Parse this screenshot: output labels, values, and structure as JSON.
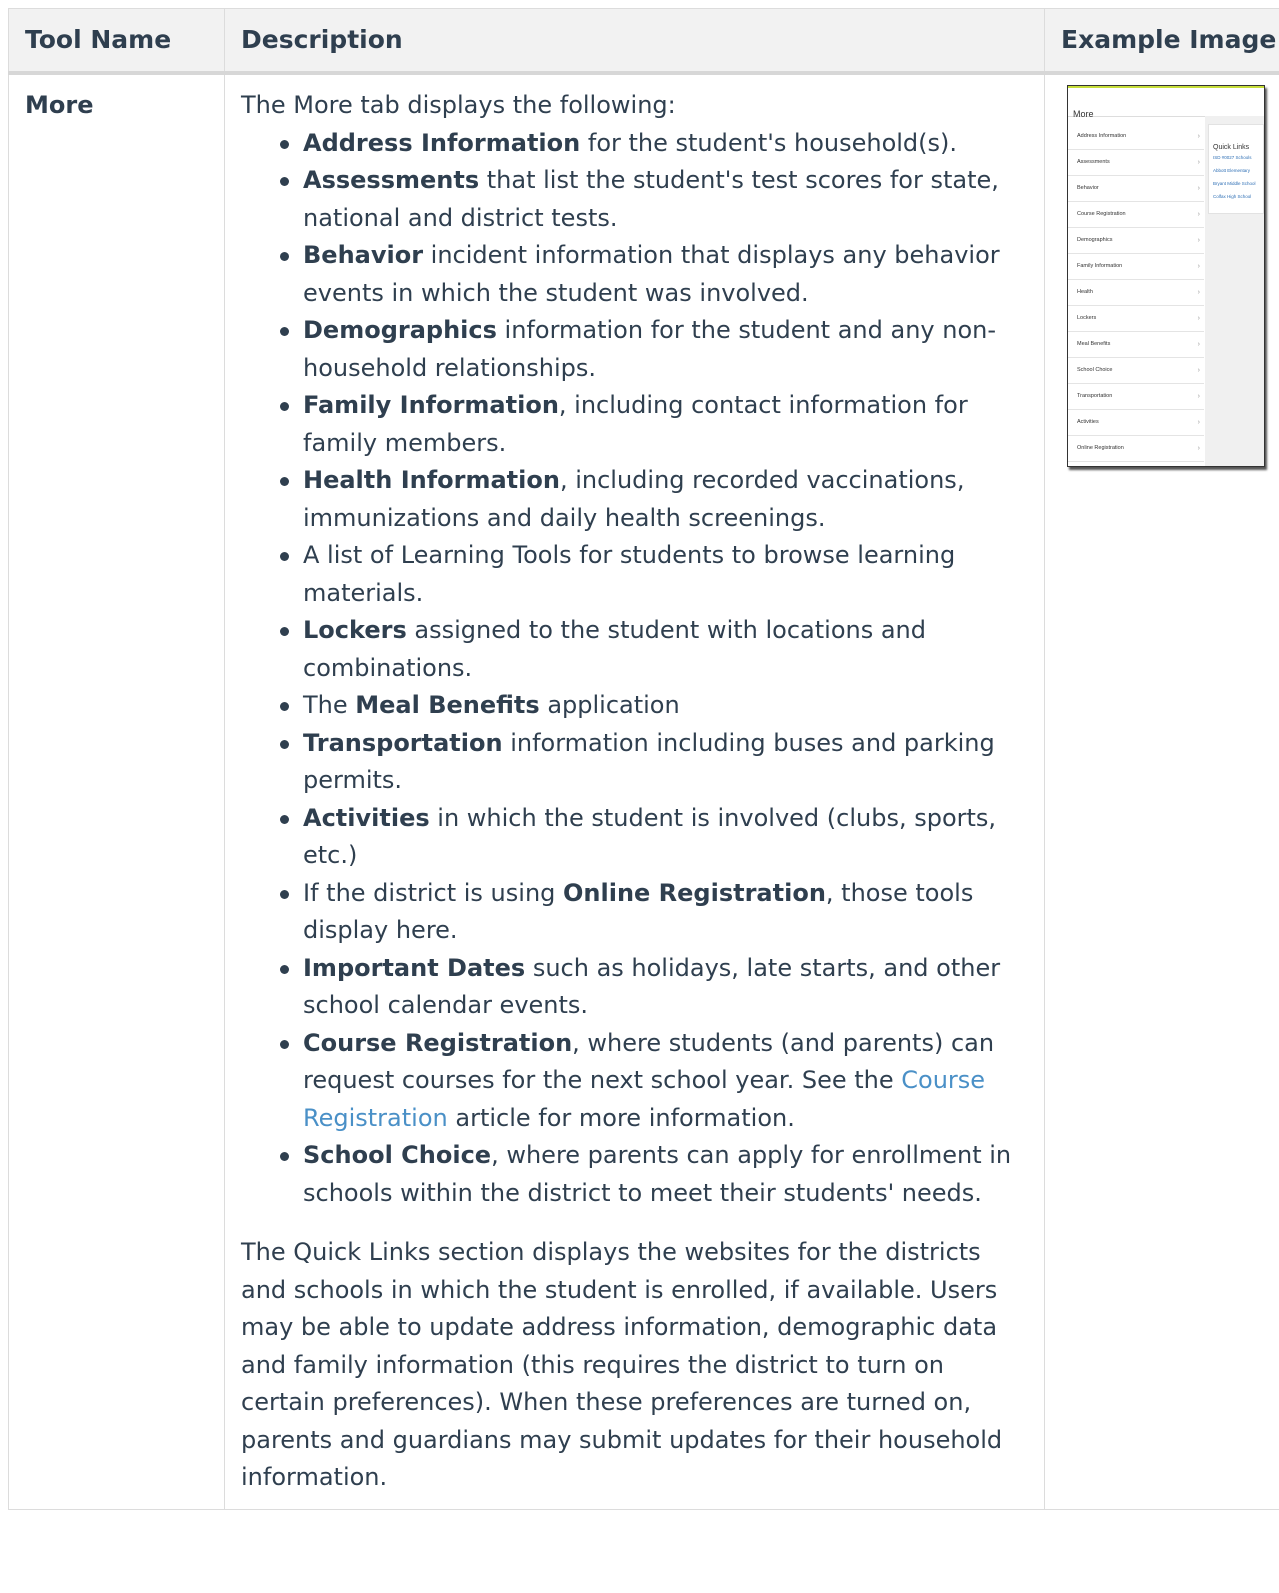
{
  "table": {
    "headers": [
      "Tool Name",
      "Description",
      "Example Image"
    ]
  },
  "row": {
    "tool_name": "More",
    "intro": "The More tab displays the following:",
    "items": [
      {
        "pre": "",
        "bold": "Address Information",
        "post": " for the student's household(s)."
      },
      {
        "pre": "",
        "bold": "Assessments",
        "post": " that list the student's test scores for state, national and district tests."
      },
      {
        "pre": "",
        "bold": "Behavior",
        "post": " incident information that displays any behavior events in which the student was involved."
      },
      {
        "pre": "",
        "bold": "Demographics",
        "post": " information for the student and any non-household relationships."
      },
      {
        "pre": "",
        "bold": "Family Information",
        "post": ", including contact information for family members."
      },
      {
        "pre": "",
        "bold": "Health Information",
        "post": ", including recorded vaccinations, immunizations and daily health screenings."
      },
      {
        "pre": "A list of Learning Tools for students to browse learning materials.",
        "bold": "",
        "post": ""
      },
      {
        "pre": "",
        "bold": "Lockers",
        "post": " assigned to the student with locations and combinations."
      },
      {
        "pre": "The ",
        "bold": "Meal Benefits",
        "post": " application"
      },
      {
        "pre": "",
        "bold": "Transportation",
        "post": " information including buses and parking permits."
      },
      {
        "pre": "",
        "bold": "Activities",
        "post": " in which the student is involved (clubs, sports, etc.)"
      },
      {
        "pre": "If the district is using ",
        "bold": "Online Registration",
        "post": ", those tools display here."
      },
      {
        "pre": "",
        "bold": "Important Dates",
        "post": " such as holidays, late starts, and other school calendar events."
      }
    ],
    "course_registration": {
      "bold": "Course Registration",
      "text1": ", where students (and parents) can request courses for the next school year. See the ",
      "link": "Course Registration",
      "text2": " article for more information."
    },
    "school_choice": {
      "bold": "School Choice",
      "text": ", where parents can apply for enrollment in schools within the district to meet their students' needs."
    },
    "quick_links_paragraph": "The Quick Links section displays the websites for the districts and schools in which the student is enrolled, if available. Users may be able to update address information, demographic data and family information (this requires the district to turn on certain preferences). When these preferences are turned on, parents and guardians may submit updates for their household information."
  },
  "example_image": {
    "title": "More",
    "list": [
      "Address Information",
      "Assessments",
      "Behavior",
      "Course Registration",
      "Demographics",
      "Family Information",
      "Health",
      "Lockers",
      "Meal Benefits",
      "School Choice",
      "Transportation",
      "Activities",
      "Online Registration"
    ],
    "quick_links_title": "Quick Links",
    "quick_links": [
      "ISD #0027 Schools",
      "Abbott Elementary",
      "Bryant Middle School",
      "Colfax High School"
    ]
  },
  "colors": {
    "text": "#2f3f4f",
    "link": "#4a90c7",
    "header_bg": "#f2f2f2",
    "border": "#dcdcdc",
    "accent_bar": "#c7de3a"
  }
}
